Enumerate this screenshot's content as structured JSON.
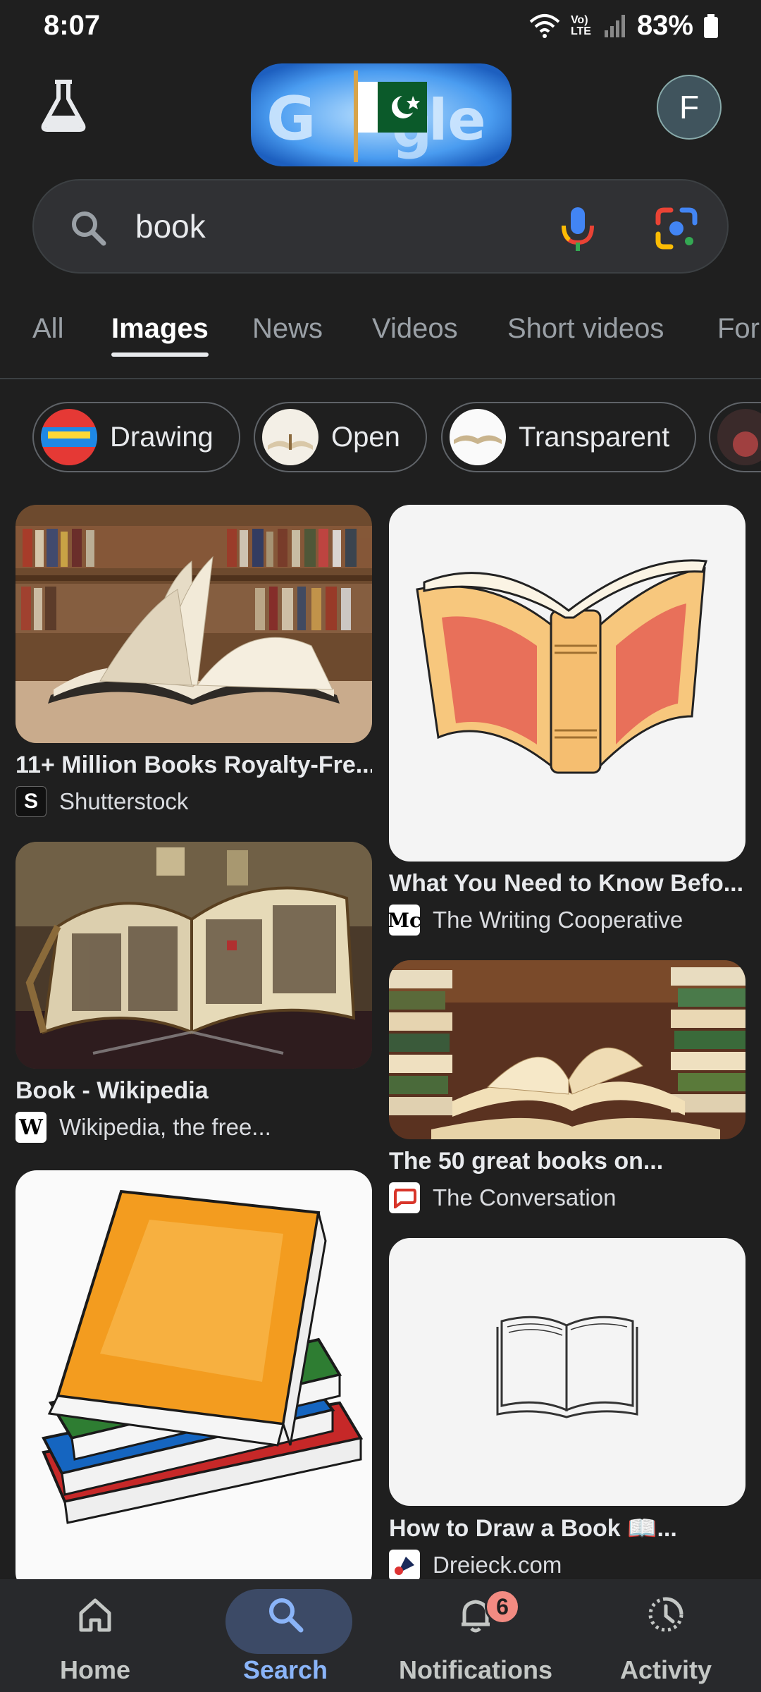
{
  "status": {
    "time": "8:07",
    "battery": "83%",
    "network": "Vo) LTE"
  },
  "header": {
    "avatar_letter": "F"
  },
  "search": {
    "query": "book"
  },
  "tabs": [
    {
      "label": "All"
    },
    {
      "label": "Images"
    },
    {
      "label": "News"
    },
    {
      "label": "Videos"
    },
    {
      "label": "Short videos"
    },
    {
      "label": "For"
    }
  ],
  "chips": [
    {
      "label": "Drawing"
    },
    {
      "label": "Open"
    },
    {
      "label": "Transparent"
    }
  ],
  "results": [
    {
      "title": "11+ Million Books Royalty-Fre...",
      "source": "Shutterstock",
      "favicon": "S"
    },
    {
      "title": "What You Need to Know Befo...",
      "source": "The Writing Cooperative",
      "favicon": "Mc"
    },
    {
      "title": "Book - Wikipedia",
      "source": "Wikipedia, the free...",
      "favicon": "W"
    },
    {
      "title": "The 50 great books on...",
      "source": "The Conversation",
      "favicon": ""
    },
    {
      "title": "",
      "source": "",
      "favicon": ""
    },
    {
      "title": "How to Draw a Book 📖...",
      "source": "Dreieck.com",
      "favicon": ""
    }
  ],
  "bottom_nav": [
    {
      "label": "Home",
      "icon": "home-icon"
    },
    {
      "label": "Search",
      "icon": "search-icon"
    },
    {
      "label": "Notifications",
      "icon": "bell-icon",
      "badge": "6"
    },
    {
      "label": "Activity",
      "icon": "activity-icon"
    }
  ]
}
